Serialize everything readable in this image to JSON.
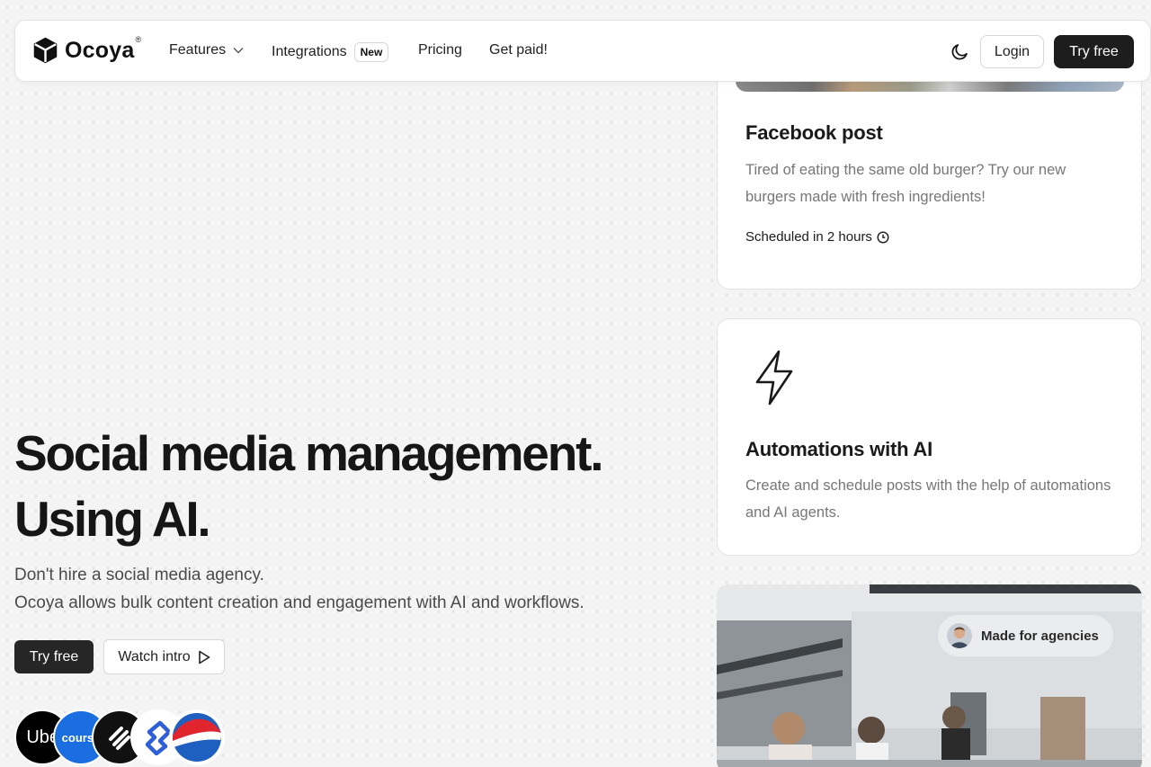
{
  "nav": {
    "brand": "Ocoya",
    "brand_mark": "®",
    "items": [
      {
        "label": "Features"
      },
      {
        "label": "Integrations",
        "badge": "New"
      },
      {
        "label": "Pricing"
      },
      {
        "label": "Get paid!"
      }
    ],
    "login_label": "Login",
    "try_label": "Try free",
    "theme_icon": "moon-icon"
  },
  "hero": {
    "title_line1": "Social media management.",
    "title_line2": "Using AI.",
    "subtitle_line1": "Don't hire a social media agency.",
    "subtitle_line2": "Ocoya allows bulk content creation and engagement with AI and workflows.",
    "try_label": "Try free",
    "watch_label": "Watch intro",
    "customer_logos": [
      "Uber",
      "course",
      "squarespace",
      "toptal",
      "pepsi"
    ],
    "uber_text": "Uber",
    "course_text": "course"
  },
  "cards": {
    "facebook": {
      "title": "Facebook post",
      "text": "Tired of eating the same old burger? Try our new burgers made with fresh ingredients!",
      "schedule": "Scheduled in 2 hours",
      "schedule_icon": "clock-icon"
    },
    "automations": {
      "title": "Automations with AI",
      "text": "Create and schedule posts with the help of automations and AI agents.",
      "icon": "lightning-icon"
    },
    "agencies": {
      "pill": "Made for agencies"
    }
  },
  "colors": {
    "dark_button": "#1d1d1d",
    "background": "#f4f4f4",
    "card": "#ffffff",
    "muted_text": "#777777"
  }
}
